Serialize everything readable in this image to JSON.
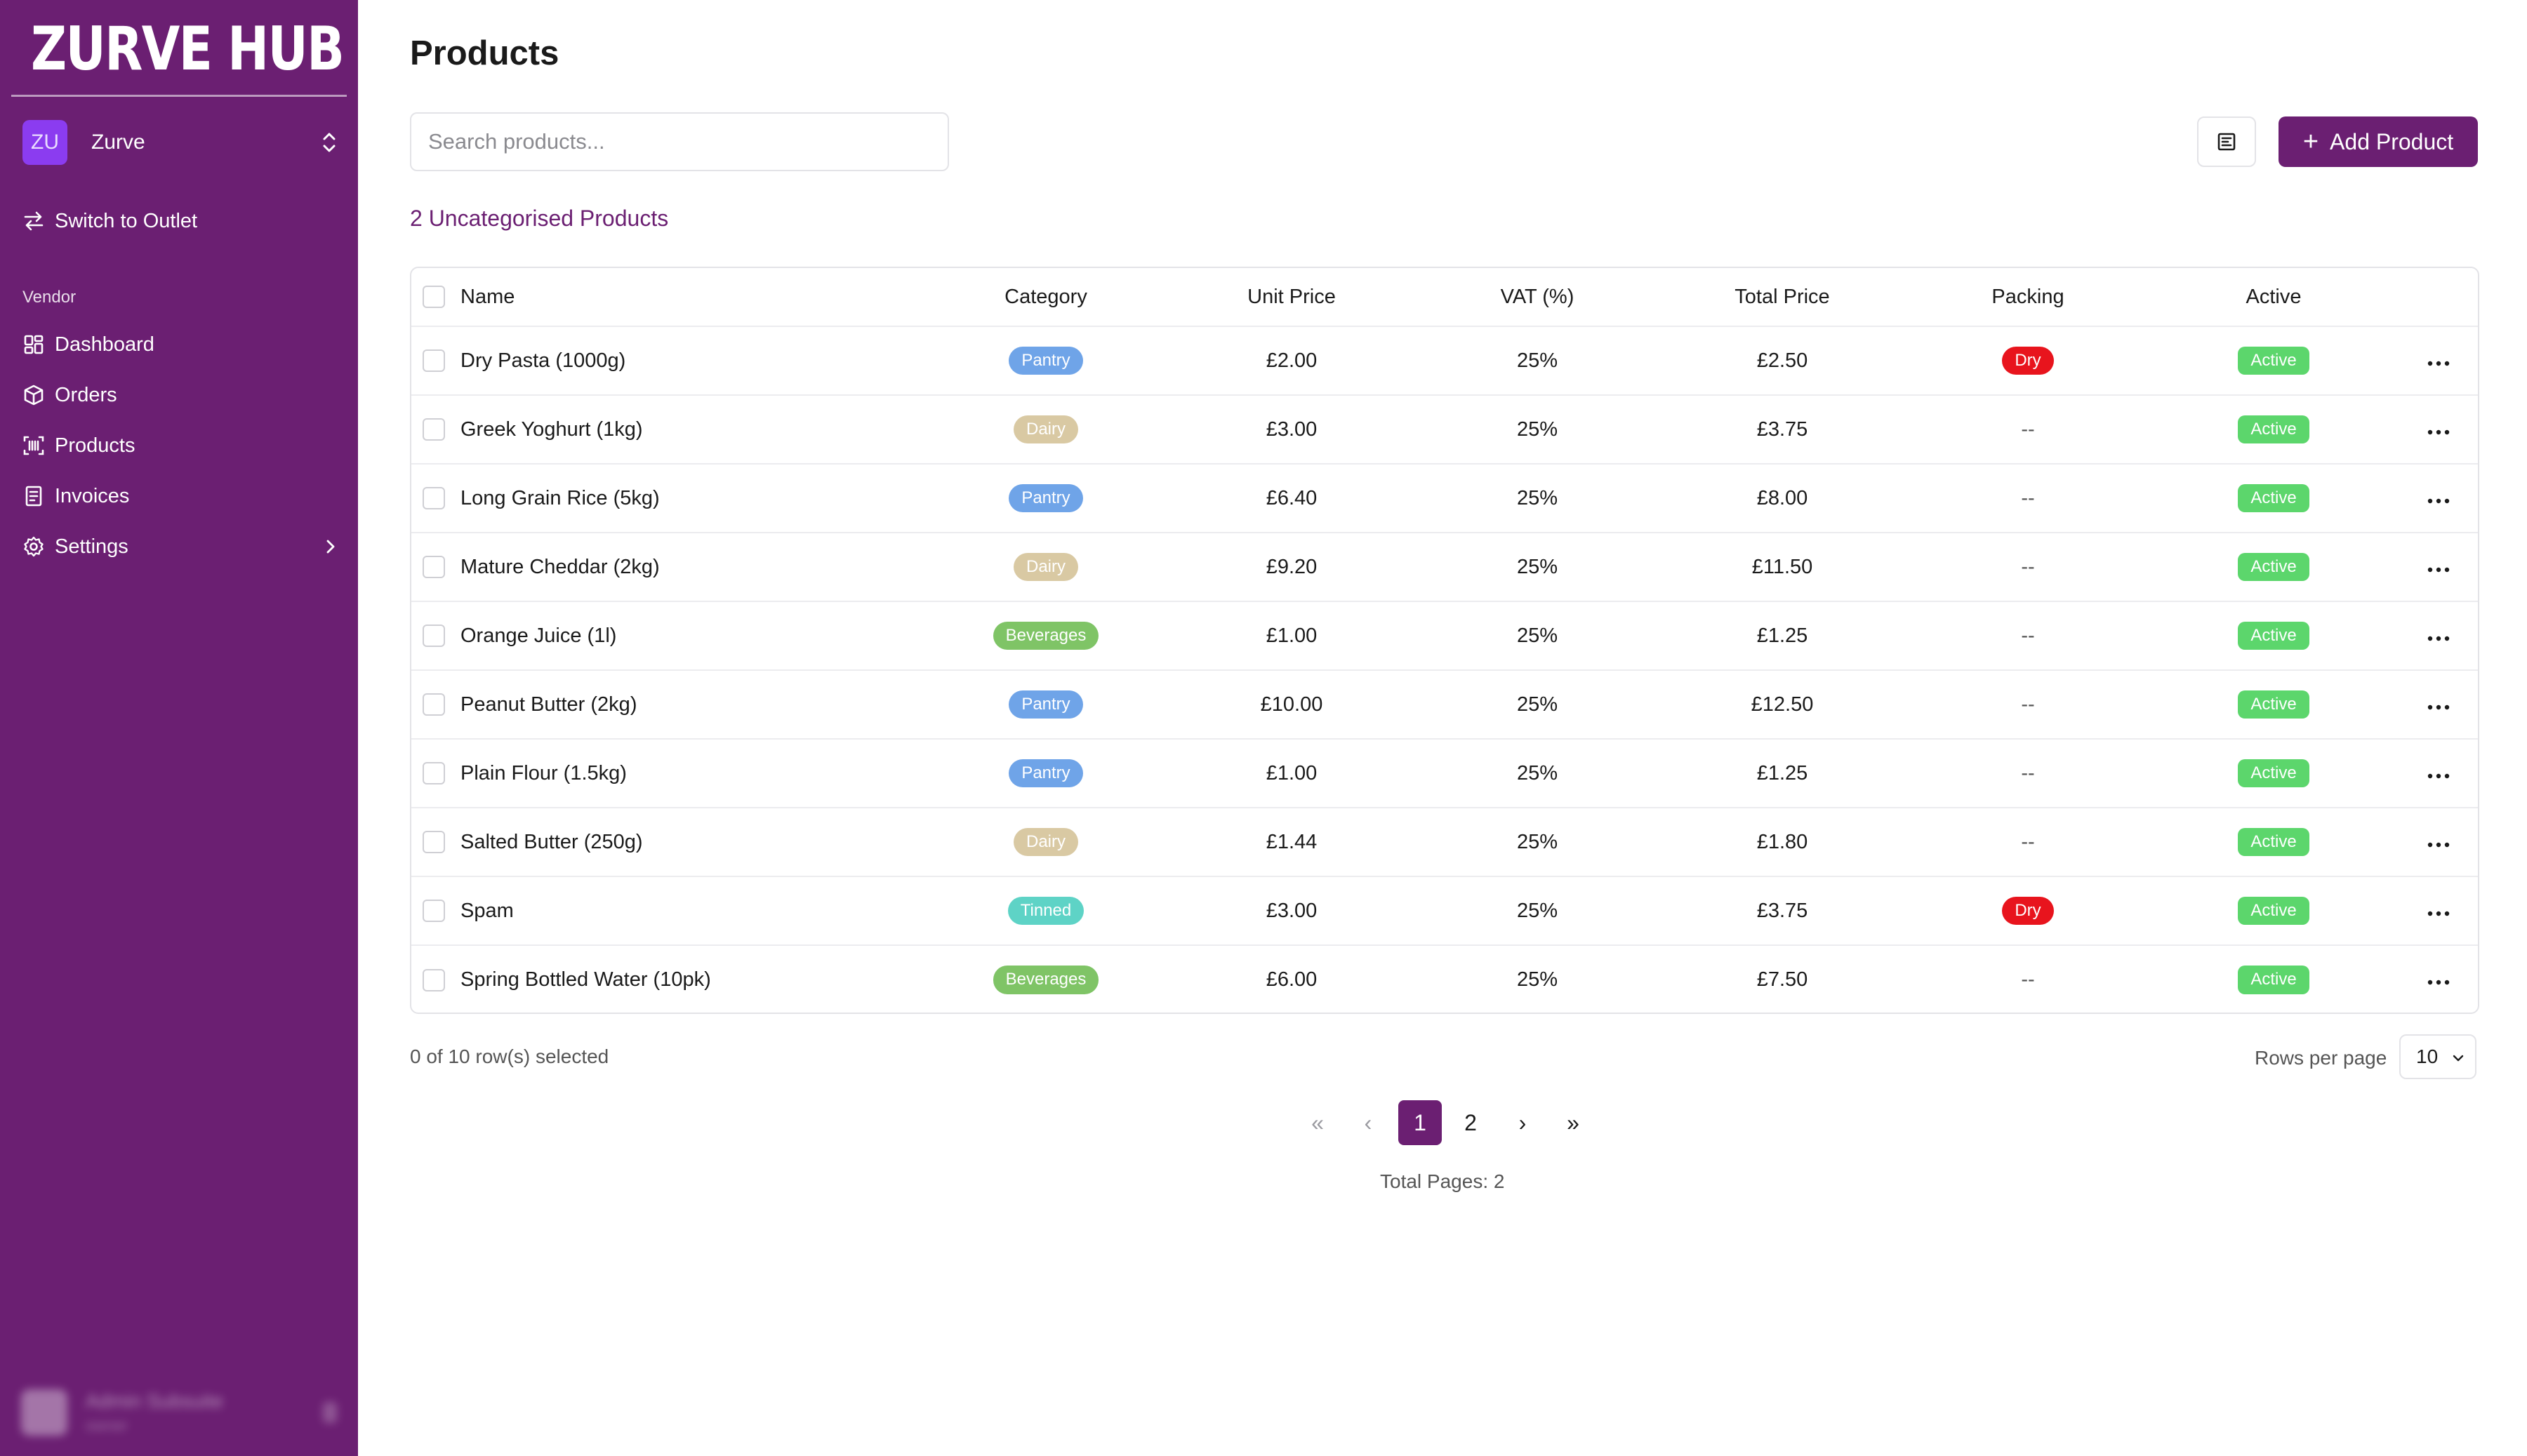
{
  "sidebar": {
    "brand": "ZURVE HUB",
    "org": {
      "initials": "ZU",
      "name": "Zurve"
    },
    "switch_label": "Switch to Outlet",
    "section_label": "Vendor",
    "items": [
      {
        "label": "Dashboard",
        "icon": "dashboard-icon"
      },
      {
        "label": "Orders",
        "icon": "box-icon"
      },
      {
        "label": "Products",
        "icon": "barcode-icon"
      },
      {
        "label": "Invoices",
        "icon": "invoice-icon"
      },
      {
        "label": "Settings",
        "icon": "gear-icon"
      }
    ],
    "user": {
      "name": "Admin Subsuite",
      "role": "owner"
    }
  },
  "page": {
    "title": "Products",
    "search_placeholder": "Search products...",
    "add_label": "Add Product",
    "uncategorised_link": "2 Uncategorised Products"
  },
  "table": {
    "headers": [
      "Name",
      "Category",
      "Unit Price",
      "VAT (%)",
      "Total Price",
      "Packing",
      "Active"
    ],
    "rows": [
      {
        "name": "Dry Pasta (1000g)",
        "category": "Pantry",
        "unit": "£2.00",
        "vat": "25%",
        "total": "£2.50",
        "packing": "Dry",
        "active": "Active"
      },
      {
        "name": "Greek Yoghurt (1kg)",
        "category": "Dairy",
        "unit": "£3.00",
        "vat": "25%",
        "total": "£3.75",
        "packing": "--",
        "active": "Active"
      },
      {
        "name": "Long Grain Rice (5kg)",
        "category": "Pantry",
        "unit": "£6.40",
        "vat": "25%",
        "total": "£8.00",
        "packing": "--",
        "active": "Active"
      },
      {
        "name": "Mature Cheddar (2kg)",
        "category": "Dairy",
        "unit": "£9.20",
        "vat": "25%",
        "total": "£11.50",
        "packing": "--",
        "active": "Active"
      },
      {
        "name": "Orange Juice (1l)",
        "category": "Beverages",
        "unit": "£1.00",
        "vat": "25%",
        "total": "£1.25",
        "packing": "--",
        "active": "Active"
      },
      {
        "name": "Peanut Butter (2kg)",
        "category": "Pantry",
        "unit": "£10.00",
        "vat": "25%",
        "total": "£12.50",
        "packing": "--",
        "active": "Active"
      },
      {
        "name": "Plain Flour (1.5kg)",
        "category": "Pantry",
        "unit": "£1.00",
        "vat": "25%",
        "total": "£1.25",
        "packing": "--",
        "active": "Active"
      },
      {
        "name": "Salted Butter (250g)",
        "category": "Dairy",
        "unit": "£1.44",
        "vat": "25%",
        "total": "£1.80",
        "packing": "--",
        "active": "Active"
      },
      {
        "name": "Spam",
        "category": "Tinned",
        "unit": "£3.00",
        "vat": "25%",
        "total": "£3.75",
        "packing": "Dry",
        "active": "Active"
      },
      {
        "name": "Spring Bottled Water (10pk)",
        "category": "Beverages",
        "unit": "£6.00",
        "vat": "25%",
        "total": "£7.50",
        "packing": "--",
        "active": "Active"
      }
    ]
  },
  "footer": {
    "selected_text": "0 of 10 row(s) selected",
    "rows_per_page_label": "Rows per page",
    "rows_per_page_value": "10",
    "pages": [
      "1",
      "2"
    ],
    "current_page": "1",
    "first": "«",
    "prev": "‹",
    "next": "›",
    "last": "»",
    "total_pages_text": "Total Pages: 2"
  },
  "colors": {
    "brand": "#6b1f72",
    "pantry": "#6fa4e8",
    "dairy": "#d9c9a3",
    "beverages": "#7fc466",
    "tinned": "#5ed3c6",
    "active": "#5cd66c",
    "dry": "#e8141d"
  }
}
